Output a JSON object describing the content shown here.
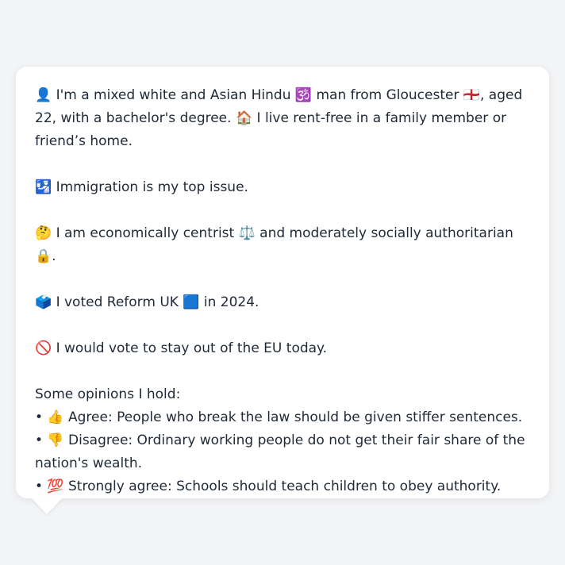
{
  "message": {
    "intro": "👤 I'm a mixed white and Asian Hindu 🕉️ man from Gloucester 🏴󠁧󠁢󠁥󠁮󠁧󠁿, aged 22, with a bachelor's degree. 🏠 I live rent-free in a family member or friend’s home.",
    "top_issue": "🛂 Immigration is my top issue.",
    "political_position": "🤔 I am economically centrist ⚖️ and moderately socially authoritarian 🔒.",
    "vote_2024": "🗳️ I voted Reform UK 🟦 in 2024.",
    "eu_vote": "🚫 I would vote to stay out of the EU today.",
    "opinions_heading": "Some opinions I hold:",
    "opinions": [
      "• 👍 Agree: People who break the law should be given stiffer sentences.",
      "• 👎 Disagree: Ordinary working people do not get their fair share of the nation's wealth.",
      "• 💯 Strongly agree: Schools should teach children to obey authority."
    ]
  }
}
